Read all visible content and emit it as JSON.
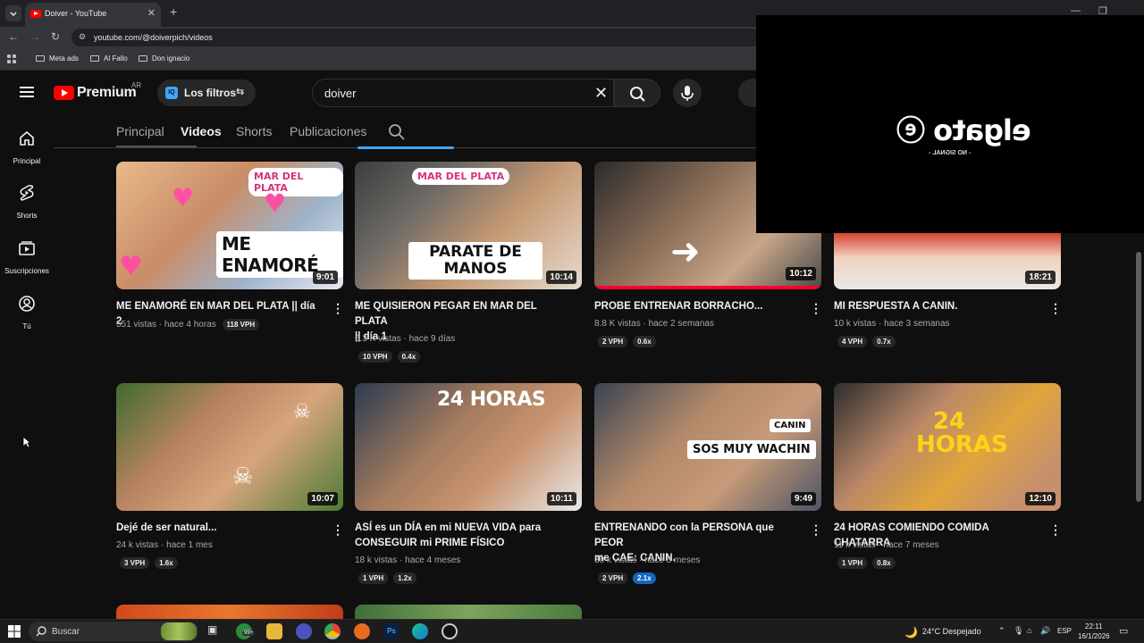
{
  "browser": {
    "tab_title": "Doiver - YouTube",
    "tab_close": "✕",
    "new_tab": "+",
    "url": "youtube.com/@doiverpich/videos",
    "bookmarks": [
      "Meta ads",
      "Al Fallo",
      "Don ignacio"
    ],
    "window_controls": [
      "—",
      "❐",
      "✕"
    ]
  },
  "youtube": {
    "logo_text": "Premium",
    "country": "AR",
    "filters_label": "Los filtros",
    "filters_icon_text": "IQ",
    "search_value": "doiver",
    "sidebar": [
      {
        "label": "Principal",
        "icon": "home-icon"
      },
      {
        "label": "Shorts",
        "icon": "shorts-icon"
      },
      {
        "label": "Suscripciones",
        "icon": "subscriptions-icon"
      },
      {
        "label": "Tú",
        "icon": "you-icon"
      }
    ],
    "channel_tabs": [
      "Principal",
      "Videos",
      "Shorts",
      "Publicaciones"
    ],
    "active_tab": "Videos",
    "accent": "#ff0000",
    "badge_highlight": "#1565c0"
  },
  "videos": [
    {
      "title_1": "ME ENAMORÉ EN MAR DEL PLATA || día 2",
      "title_2": "",
      "views": "551 vistas",
      "age": "hace 4 horas",
      "badges": [
        "118 VPH"
      ],
      "duration": "9:01",
      "overlay": "ME ENAMORÉ",
      "overlay_2": "MAR DEL PLATA",
      "watched": 0
    },
    {
      "title_1": "ME QUISIERON PEGAR EN MAR DEL PLATA",
      "title_2": "|| día 1",
      "views": "6.3 K vistas",
      "age": "hace 9 días",
      "badges": [
        "10 VPH",
        "0.4x"
      ],
      "duration": "10:14",
      "overlay": "PARATE DE MANOS",
      "overlay_2": "MAR DEL PLATA",
      "watched": 0
    },
    {
      "title_1": "PROBE ENTRENAR BORRACHO...",
      "title_2": "",
      "views": "8.8 K vistas",
      "age": "hace 2 semanas",
      "badges": [
        "2 VPH",
        "0.6x"
      ],
      "duration": "10:12",
      "overlay": "",
      "overlay_2": "",
      "watched": 1
    },
    {
      "title_1": "MI RESPUESTA A CANIN.",
      "title_2": "",
      "views": "10 k vistas",
      "age": "hace 3 semanas",
      "badges": [
        "4 VPH",
        "0.7x"
      ],
      "duration": "18:21",
      "overlay": "",
      "overlay_2": "",
      "watched": 0
    },
    {
      "title_1": "Dejé de ser natural...",
      "title_2": "",
      "views": "24 k vistas",
      "age": "hace 1 mes",
      "badges": [
        "3 VPH",
        "1.6x"
      ],
      "duration": "10:07",
      "overlay": "",
      "overlay_2": "",
      "watched": 0
    },
    {
      "title_1": "ASÍ es un DÍA en mi NUEVA VIDA para",
      "title_2": "CONSEGUIR mi PRIME FÍSICO",
      "views": "18 k vistas",
      "age": "hace 4 meses",
      "badges": [
        "1 VPH",
        "1.2x"
      ],
      "duration": "10:11",
      "overlay": "24 HORAS",
      "overlay_2": "",
      "watched": 0
    },
    {
      "title_1": "ENTRENANDO con la PERSONA que PEOR",
      "title_2": "me CAE: CANIN.",
      "views": "30 k vistas",
      "age": "hace 5 meses",
      "badges": [
        "2 VPH",
        "2.1x"
      ],
      "duration": "9:49",
      "overlay": "SOS MUY WACHIN",
      "overlay_2": "CANIN",
      "watched": 0
    },
    {
      "title_1": "24 HORAS COMIENDO COMIDA CHATARRA",
      "title_2": "",
      "views": "11 k vistas",
      "age": "hace 7 meses",
      "badges": [
        "1 VPH",
        "0.8x"
      ],
      "duration": "12:10",
      "overlay": "24 HORAS",
      "overlay_2": "",
      "watched": 0
    }
  ],
  "elgato": {
    "logo": "elgato",
    "status": "- NO SIGNAL -"
  },
  "taskbar": {
    "search_label": "Buscar",
    "weather": "24°C  Despejado",
    "lang": "ESP",
    "time": "22:11",
    "date": "16/1/2026",
    "notif_badge": "99+"
  }
}
